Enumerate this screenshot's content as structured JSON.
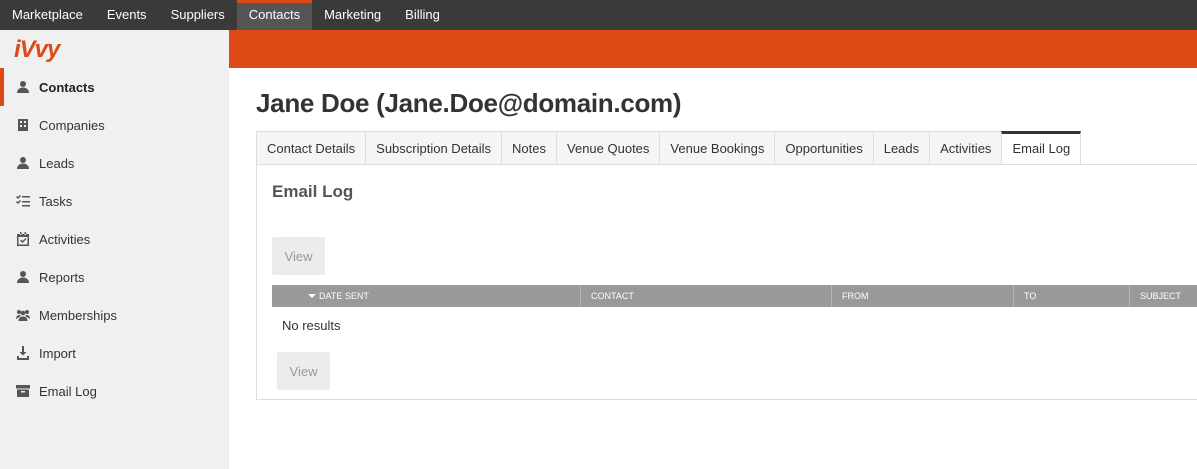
{
  "topnav": {
    "items": [
      {
        "label": "Marketplace"
      },
      {
        "label": "Events"
      },
      {
        "label": "Suppliers"
      },
      {
        "label": "Contacts",
        "active": true
      },
      {
        "label": "Marketing"
      },
      {
        "label": "Billing"
      }
    ]
  },
  "logo": {
    "text": "iVvy"
  },
  "sidebar": {
    "items": [
      {
        "label": "Contacts",
        "icon": "user-icon",
        "active": true
      },
      {
        "label": "Companies",
        "icon": "building-icon"
      },
      {
        "label": "Leads",
        "icon": "user-icon"
      },
      {
        "label": "Tasks",
        "icon": "checklist-icon"
      },
      {
        "label": "Activities",
        "icon": "calendar-check-icon"
      },
      {
        "label": "Reports",
        "icon": "user-icon"
      },
      {
        "label": "Memberships",
        "icon": "users-icon"
      },
      {
        "label": "Import",
        "icon": "download-icon"
      },
      {
        "label": "Email Log",
        "icon": "archive-icon"
      }
    ]
  },
  "page": {
    "title": "Jane Doe (Jane.Doe@domain.com)"
  },
  "tabs": [
    {
      "label": "Contact Details"
    },
    {
      "label": "Subscription Details"
    },
    {
      "label": "Notes"
    },
    {
      "label": "Venue Quotes"
    },
    {
      "label": "Venue Bookings"
    },
    {
      "label": "Opportunities"
    },
    {
      "label": "Leads"
    },
    {
      "label": "Activities"
    },
    {
      "label": "Email Log",
      "active": true
    }
  ],
  "panel": {
    "title": "Email Log",
    "view_button_label": "View",
    "no_results": "No results",
    "columns": [
      {
        "label": "Date Sent",
        "sorted": "desc"
      },
      {
        "label": "Contact"
      },
      {
        "label": "From"
      },
      {
        "label": "To"
      },
      {
        "label": "Subject"
      }
    ]
  },
  "colors": {
    "accent": "#de4a16",
    "topnav_bg": "#3a3a3a",
    "sidebar_bg": "#f0f0f0",
    "grid_header_bg": "#999999"
  }
}
